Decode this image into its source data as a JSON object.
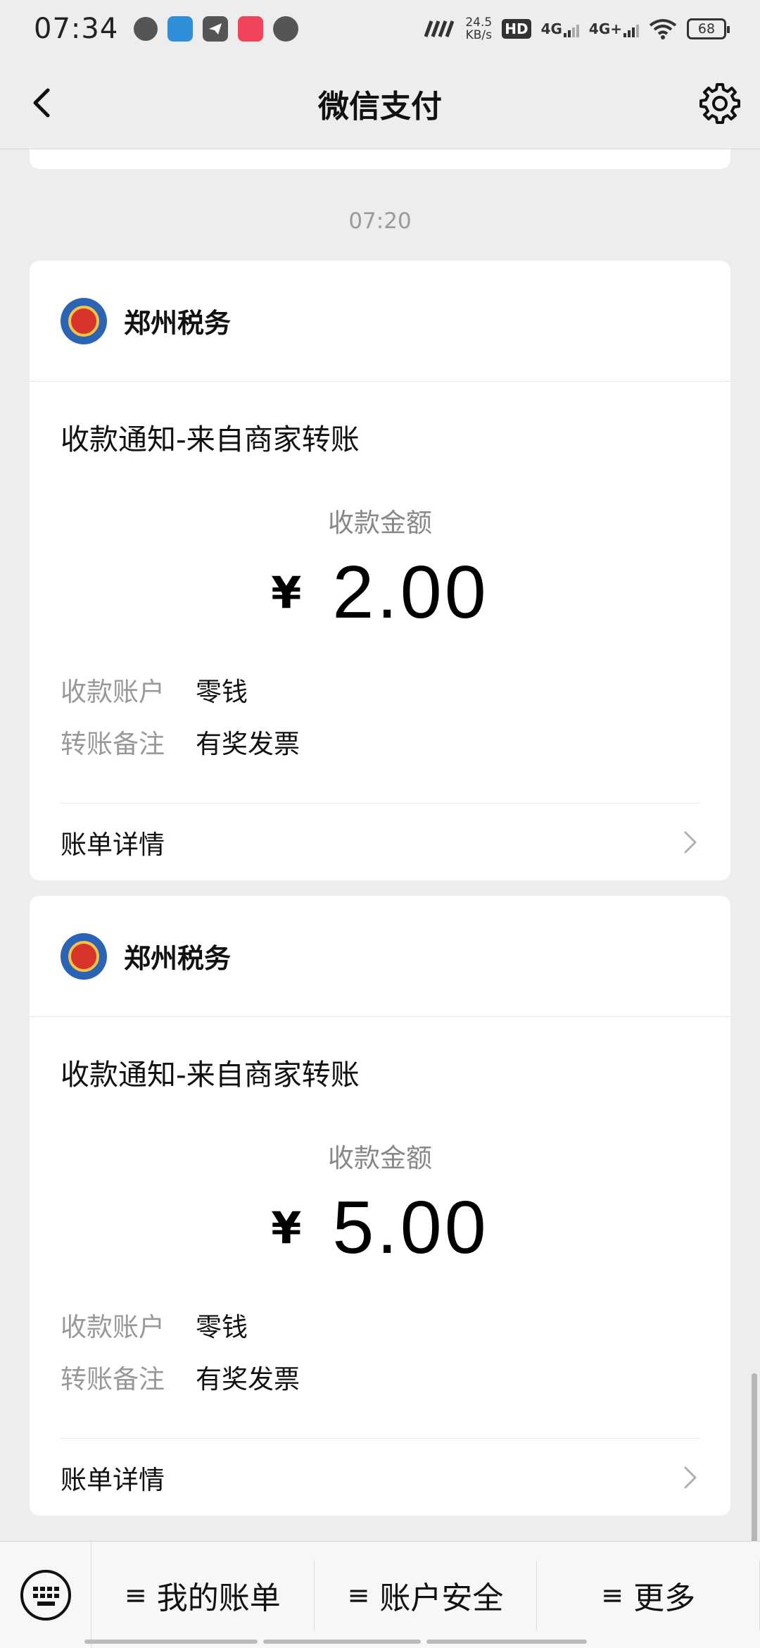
{
  "status_bar": {
    "time": "07:34",
    "net_speed_value": "24.5",
    "net_speed_unit": "KB/s",
    "hd_label": "HD",
    "signal1_label": "4G",
    "signal2_label": "4G+",
    "battery": "68"
  },
  "nav": {
    "title": "微信支付"
  },
  "timestamp": "07:20",
  "cards": [
    {
      "merchant": "郑州税务",
      "title": "收款通知-来自商家转账",
      "amount_label": "收款金额",
      "currency": "¥",
      "amount": "2.00",
      "account_key": "收款账户",
      "account_val": "零钱",
      "remark_key": "转账备注",
      "remark_val": "有奖发票",
      "bill_link": "账单详情"
    },
    {
      "merchant": "郑州税务",
      "title": "收款通知-来自商家转账",
      "amount_label": "收款金额",
      "currency": "¥",
      "amount": "5.00",
      "account_key": "收款账户",
      "account_val": "零钱",
      "remark_key": "转账备注",
      "remark_val": "有奖发票",
      "bill_link": "账单详情"
    }
  ],
  "bottom_menu": {
    "items": [
      {
        "glyph": "≡",
        "label": "我的账单"
      },
      {
        "glyph": "≡",
        "label": "账户安全"
      },
      {
        "glyph": "≡",
        "label": "更多"
      }
    ]
  },
  "icons": {
    "back": "chevron-left-icon",
    "settings": "gear-icon",
    "keyboard": "keyboard-icon"
  }
}
